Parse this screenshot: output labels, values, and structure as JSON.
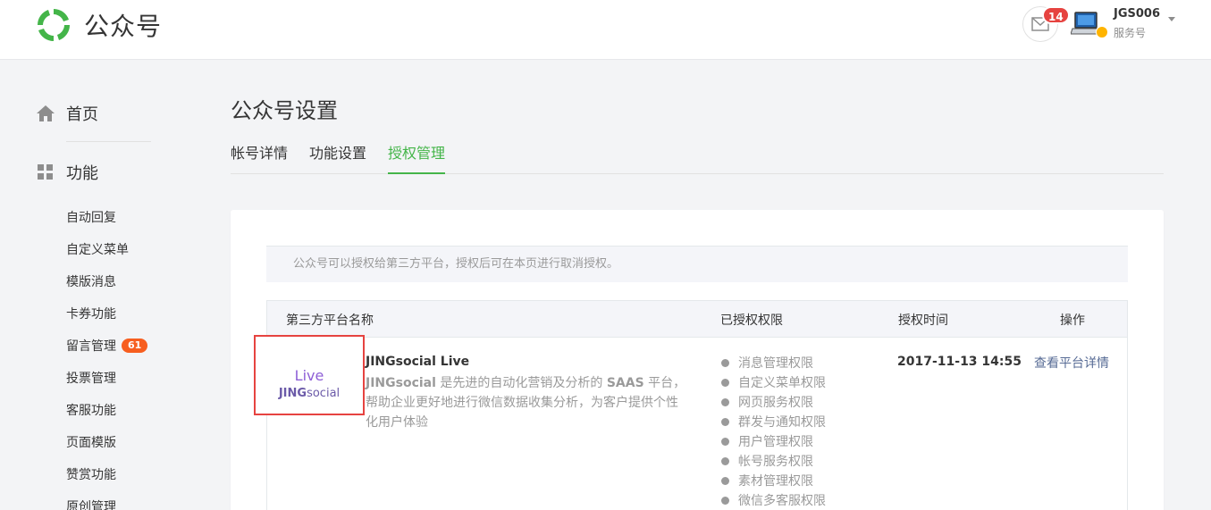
{
  "header": {
    "app_title": "公众号",
    "message_count": "14",
    "account_name": "JGS006",
    "account_type": "服务号"
  },
  "sidebar": {
    "home_label": "首页",
    "function_label": "功能",
    "items": [
      {
        "label": "自动回复"
      },
      {
        "label": "自定义菜单"
      },
      {
        "label": "模版消息"
      },
      {
        "label": "卡券功能"
      },
      {
        "label": "留言管理",
        "badge": "61"
      },
      {
        "label": "投票管理"
      },
      {
        "label": "客服功能"
      },
      {
        "label": "页面模版"
      },
      {
        "label": "赞赏功能"
      },
      {
        "label": "原创管理"
      }
    ]
  },
  "main": {
    "page_title": "公众号设置",
    "tabs": [
      {
        "label": "帐号详情"
      },
      {
        "label": "功能设置"
      },
      {
        "label": "授权管理",
        "active": true
      }
    ],
    "notice": "公众号可以授权给第三方平台，授权后可在本页进行取消授权。",
    "table": {
      "headers": [
        "第三方平台名称",
        "已授权权限",
        "授权时间",
        "操作"
      ],
      "rows": [
        {
          "logo_top": "Live",
          "logo_bottom_bold": "JING",
          "logo_bottom_rest": "social",
          "name": "JINGsocial Live",
          "desc_brand": "JINGsocial",
          "desc_mid": " 是先进的自动化营销及分析的 ",
          "desc_saas": "SAAS",
          "desc_rest": " 平台，帮助企业更好地进行微信数据收集分析，为客户提供个性化用户体验",
          "permissions": [
            "消息管理权限",
            "自定义菜单权限",
            "网页服务权限",
            "群发与通知权限",
            "用户管理权限",
            "帐号服务权限",
            "素材管理权限",
            "微信多客服权限"
          ],
          "auth_time": "2017-11-13 14:55",
          "action": "查看平台详情"
        }
      ]
    }
  },
  "colors": {
    "accent_green": "#44b549",
    "badge_red": "#e64340",
    "badge_orange": "#f75e1f",
    "link_blue": "#576b95",
    "highlight_box": "#e64340"
  }
}
